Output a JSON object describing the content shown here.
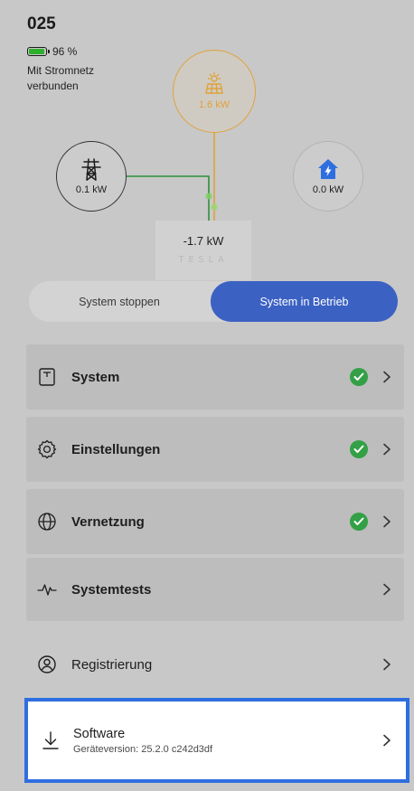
{
  "site": {
    "name": "025",
    "battery_percent": "96 %",
    "battery_level": 0.96,
    "grid_status": "Mit Stromnetz verbunden"
  },
  "flow": {
    "solar_power": "1.6 kW",
    "grid_power": "0.1 kW",
    "home_power": "0.0 kW",
    "gateway_power": "-1.7 kW",
    "gateway_brand": "TESLA",
    "colors": {
      "solar": "#e0a23a",
      "grid": "#2f8f3a",
      "home": "#2f6ee0"
    }
  },
  "toggle": {
    "stop_label": "System stoppen",
    "run_label": "System in Betrieb",
    "active": "run",
    "accent": "#3b61c3"
  },
  "menu": {
    "items": [
      {
        "label": "System",
        "icon": "device-icon",
        "status": "ok"
      },
      {
        "label": "Einstellungen",
        "icon": "gear-icon",
        "status": "ok"
      },
      {
        "label": "Vernetzung",
        "icon": "globe-icon",
        "status": "ok"
      },
      {
        "label": "Systemtests",
        "icon": "pulse-icon",
        "status": ""
      },
      {
        "label": "Registrierung",
        "icon": "user-icon",
        "status": ""
      }
    ],
    "software": {
      "title": "Software",
      "subtitle": "Geräteversion: 25.2.0 c242d3df",
      "icon": "download-icon",
      "highlight_color": "#2f6ee0"
    }
  }
}
